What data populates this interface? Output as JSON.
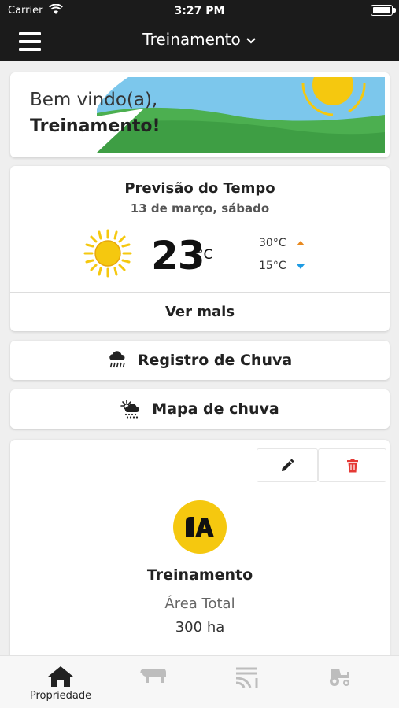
{
  "status_bar": {
    "carrier": "Carrier",
    "time": "3:27 PM"
  },
  "header": {
    "title": "Treinamento"
  },
  "welcome": {
    "greeting": "Bem vindo(a),",
    "name": "Treinamento!"
  },
  "weather": {
    "title": "Previsão do Tempo",
    "date": "13 de março, sábado",
    "temperature": "23",
    "unit": "°C",
    "max": "30°C",
    "min": "15°C",
    "more_label": "Ver mais",
    "icon": "sun-icon"
  },
  "actions": {
    "rain_record": "Registro de Chuva",
    "rain_map": "Mapa de chuva"
  },
  "property": {
    "name": "Treinamento",
    "area_label": "Área Total",
    "area_value": "300 ha"
  },
  "bottom_nav": {
    "items": [
      {
        "label": "Propriedade",
        "icon": "home-icon",
        "active": true
      },
      {
        "label": "",
        "icon": "cattle-icon",
        "active": false
      },
      {
        "label": "",
        "icon": "field-icon",
        "active": false
      },
      {
        "label": "",
        "icon": "tractor-icon",
        "active": false
      }
    ]
  },
  "colors": {
    "header_bg": "#1b1b1b",
    "accent_yellow": "#f5c80f",
    "up_arrow": "#e8891f",
    "down_arrow": "#1e9be3",
    "delete_red": "#e53935"
  }
}
